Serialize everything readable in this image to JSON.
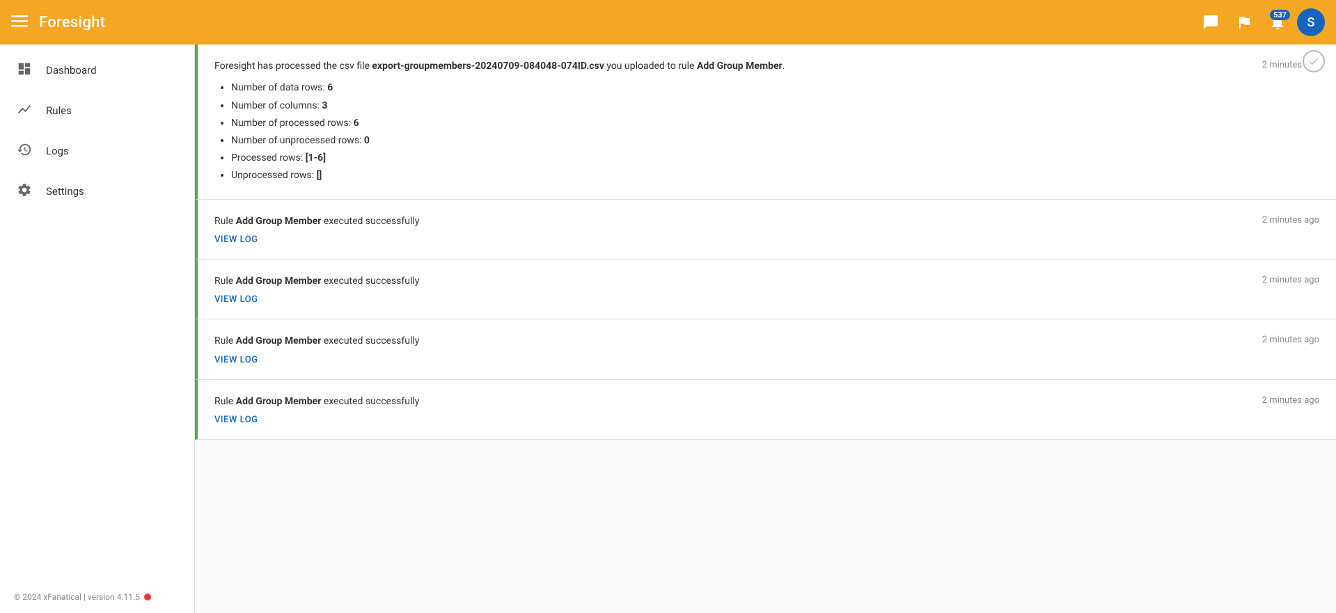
{
  "header": {
    "menu_icon": "☰",
    "title": "Foresight",
    "notification_count": "537",
    "avatar_letter": "S",
    "accent_color": "#F5A623"
  },
  "sidebar": {
    "items": [
      {
        "id": "dashboard",
        "label": "Dashboard",
        "icon": "dashboard"
      },
      {
        "id": "rules",
        "label": "Rules",
        "icon": "rules"
      },
      {
        "id": "logs",
        "label": "Logs",
        "icon": "logs"
      },
      {
        "id": "settings",
        "label": "Settings",
        "icon": "settings"
      }
    ],
    "footer": "© 2024 xFanatical | version 4.11.5"
  },
  "notifications": [
    {
      "type": "csv_processed",
      "intro": "Foresight has processed the csv file ",
      "filename": "export-groupmembers-20240709-084048-074ID.csv",
      "mid_text": " you uploaded to rule ",
      "rule_name": "Add Group Member",
      "end_text": ".",
      "stats": [
        {
          "label": "Number of data rows: ",
          "value": "6"
        },
        {
          "label": "Number of columns: ",
          "value": "3"
        },
        {
          "label": "Number of processed rows: ",
          "value": "6"
        },
        {
          "label": "Number of unprocessed rows: ",
          "value": "0"
        },
        {
          "label": "Processed rows: ",
          "value": "[1-6]"
        },
        {
          "label": "Unprocessed rows: ",
          "value": "[]"
        }
      ],
      "time": "2 minutes ago"
    },
    {
      "type": "rule_executed",
      "pre_text": "Rule ",
      "rule_name": "Add Group Member",
      "post_text": " executed successfully",
      "view_log_label": "VIEW LOG",
      "time": "2 minutes ago"
    },
    {
      "type": "rule_executed",
      "pre_text": "Rule ",
      "rule_name": "Add Group Member",
      "post_text": " executed successfully",
      "view_log_label": "VIEW LOG",
      "time": "2 minutes ago"
    },
    {
      "type": "rule_executed",
      "pre_text": "Rule ",
      "rule_name": "Add Group Member",
      "post_text": " executed successfully",
      "view_log_label": "VIEW LOG",
      "time": "2 minutes ago"
    },
    {
      "type": "rule_executed",
      "pre_text": "Rule ",
      "rule_name": "Add Group Member",
      "post_text": " executed successfully",
      "view_log_label": "VIEW LOG",
      "time": "2 minutes ago"
    }
  ]
}
